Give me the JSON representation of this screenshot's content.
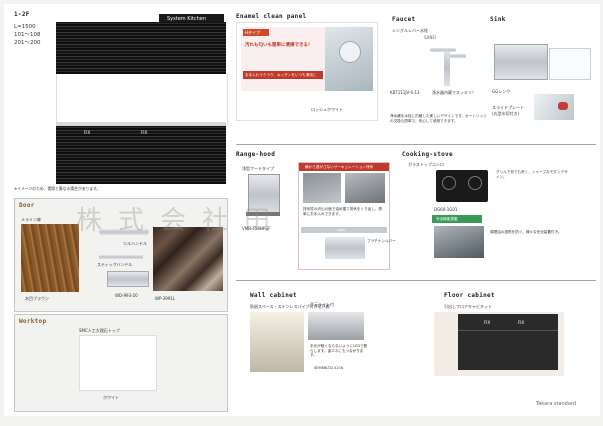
{
  "header": {
    "floor": "1-2F",
    "dims": [
      "L=1500",
      "101～108",
      "201～200"
    ],
    "product_tag": "System Kitchen"
  },
  "caption_note": "※イメージのため、実際と異なる場合があります。",
  "watermark": "株式会社田",
  "fix_label": "FIX",
  "door": {
    "title": "Door",
    "badge": "メラミン扉",
    "handle_a": "ツルハンドル",
    "handle_b": "スティックハンドル",
    "code_a": "木目ブラウン",
    "code_b": "WD-993-20",
    "code_c": "WP-3991L"
  },
  "worktop": {
    "title": "Worktop",
    "spec": "SMC人工大理石トップ",
    "colour": "ホワイト"
  },
  "enamel": {
    "title": "Enamel clean panel",
    "brand_tag": "Hタイプ",
    "headline": "汚れも匂いも簡単に清掃できる！",
    "subline": "お手入れラクラク、キッチンをいつも清潔に",
    "colour": "ロッシュホワイト"
  },
  "faucet": {
    "title": "Faucet",
    "model": "シングルレバー水栓",
    "brand": "SANEI",
    "code": "K87111JV-S-13",
    "feature": "浄水器内蔵でスッキリ！",
    "desc": "浄水器を水栓に内蔵した美しいデザインです。カートリッジの交換も簡単で、安心して使用できます。"
  },
  "sink": {
    "title": "Sink",
    "code": "GGシンク",
    "plate": "スライドプレート",
    "plate_note": "(丸型水切付き)"
  },
  "range": {
    "title": "Range-hood",
    "model_label": "浅型フードタイプ",
    "headline": "横から逃がさないサーキュレーション排気",
    "desc": "排気質の沢山の面で油め獲て排気をくり返し、簡単にお手入れできます。",
    "code": "VMR-756HFGF",
    "swatch": "color",
    "swatch_name": "プラチナシルバー"
  },
  "stove": {
    "title": "Cooking-stove",
    "model_label": "ガラストップコンロ",
    "bubble": "グリルで何でも焎く、シャープなモダンデザイン。",
    "code": "DG60-1G01",
    "safety_tag": "安全機能搭載",
    "safety_desc": "調理油の過熱を防ぐ、様々な安全装置付き。"
  },
  "wall": {
    "title": "Wall cabinet",
    "spec": "防鼠スペース・ステンレスパイプ付き吊戸棚",
    "light": "手元ライト付",
    "desc": "手元が暗くならないようにLEDで照らします。省エネにもつながります。",
    "code": "SEMEBLTD-321K"
  },
  "floor": {
    "title": "Floor cabinet",
    "spec": "引出しフロアキャビネット"
  },
  "footer": {
    "brand": "Takara standard"
  }
}
